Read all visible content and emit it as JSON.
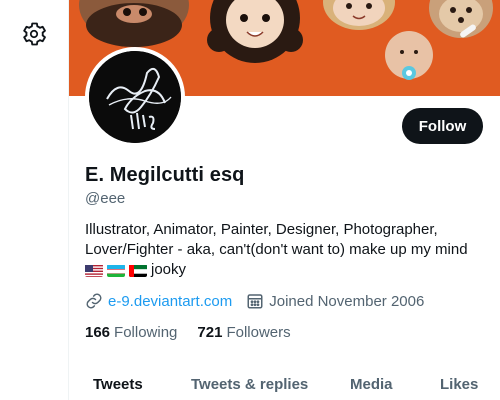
{
  "profile": {
    "name": "E. Megilcutti esq",
    "handle": "@eee",
    "bio_line1": "Illustrator, Animator, Painter, Designer, Photographer,",
    "bio_line2": "Lover/Fighter - aka, can't(don't want to) make up my mind",
    "bio_tail": "jooky",
    "website": "e-9.deviantart.com",
    "joined": "Joined November 2006",
    "following_count": "166",
    "following_label": "Following",
    "followers_count": "721",
    "followers_label": "Followers"
  },
  "actions": {
    "follow_label": "Follow"
  },
  "tabs": [
    {
      "label": "Tweets",
      "active": true
    },
    {
      "label": "Tweets & replies"
    },
    {
      "label": "Media"
    },
    {
      "label": "Likes"
    }
  ],
  "icons": {
    "settings": "gear-icon",
    "link": "link-icon",
    "calendar": "calendar-icon",
    "flags": [
      "us-flag-icon",
      "uzbekistan-flag-icon",
      "uae-flag-icon"
    ]
  },
  "colors": {
    "banner": "#e05b21",
    "accent": "#1d9bf0",
    "text": "#0f1419",
    "muted": "#536471"
  }
}
